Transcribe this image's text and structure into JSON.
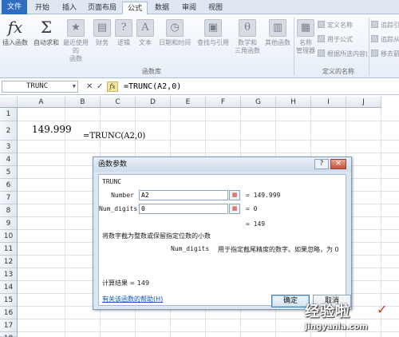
{
  "tabs": [
    {
      "label": "文件"
    },
    {
      "label": "开始"
    },
    {
      "label": "插入"
    },
    {
      "label": "页面布局"
    },
    {
      "label": "公式"
    },
    {
      "label": "数据"
    },
    {
      "label": "审阅"
    },
    {
      "label": "视图"
    }
  ],
  "ribbon": {
    "insert_function": "插入函数",
    "autosum": "自动求和",
    "recent_line1": "最近使用的",
    "recent_line2": "函数",
    "financial": "财务",
    "logical": "逻辑",
    "text": "文本",
    "datetime": "日期和时间",
    "lookup": "查找与引用",
    "math_line1": "数学和",
    "math_line2": "三角函数",
    "other": "其他函数",
    "library_group": "函数库",
    "name_mgr_line1": "名称",
    "name_mgr_line2": "管理器",
    "define_name": "定义名称",
    "use_in_formula": "用于公式",
    "create_from_selection": "根据所选内容创建",
    "defined_names_group": "定义的名称",
    "trace_precedents": "追踪引",
    "trace_dependents": "追踪从",
    "remove_arrows": "移去箭"
  },
  "formula_bar": {
    "name_box": "TRUNC",
    "x_symbol": "✕",
    "check_symbol": "✓",
    "fx_symbol": "fx",
    "formula": "=TRUNC(A2,0)"
  },
  "sheet": {
    "columns": [
      "A",
      "B",
      "C",
      "D",
      "E",
      "F",
      "G",
      "H",
      "I",
      "J"
    ],
    "rows": [
      "1",
      "2",
      "3",
      "4",
      "5",
      "6",
      "7",
      "8",
      "9",
      "10",
      "11",
      "12",
      "13",
      "14",
      "15",
      "16",
      "17",
      "18",
      "19"
    ],
    "a2": "149.999",
    "b2": "=TRUNC(A2,0)"
  },
  "dialog": {
    "title": "函数参数",
    "help_btn": "?",
    "close_btn": "✕",
    "function_name": "TRUNC",
    "arg1_label": "Number",
    "arg1_value": "A2",
    "arg1_result": "= 149.999",
    "arg2_label": "Num_digits",
    "arg2_value": "0",
    "arg2_result": "= 0",
    "formula_result": "= 149",
    "description": "将数字截为整数或保留指定位数的小数",
    "arg_help_name": "Num_digits",
    "arg_help_text": "用于指定截尾精度的数字。如果忽略，为 0",
    "calc_result": "计算结果 = 149",
    "help_link": "有关该函数的帮助(H)",
    "ok": "确定",
    "cancel": "取消"
  },
  "watermark": {
    "text": "经验啦",
    "check": "✓",
    "url": "jingyanla.com"
  },
  "colors": {
    "file_tab": "#2f6dbf",
    "link": "#0b56b5",
    "close_btn": "#c7533a"
  }
}
